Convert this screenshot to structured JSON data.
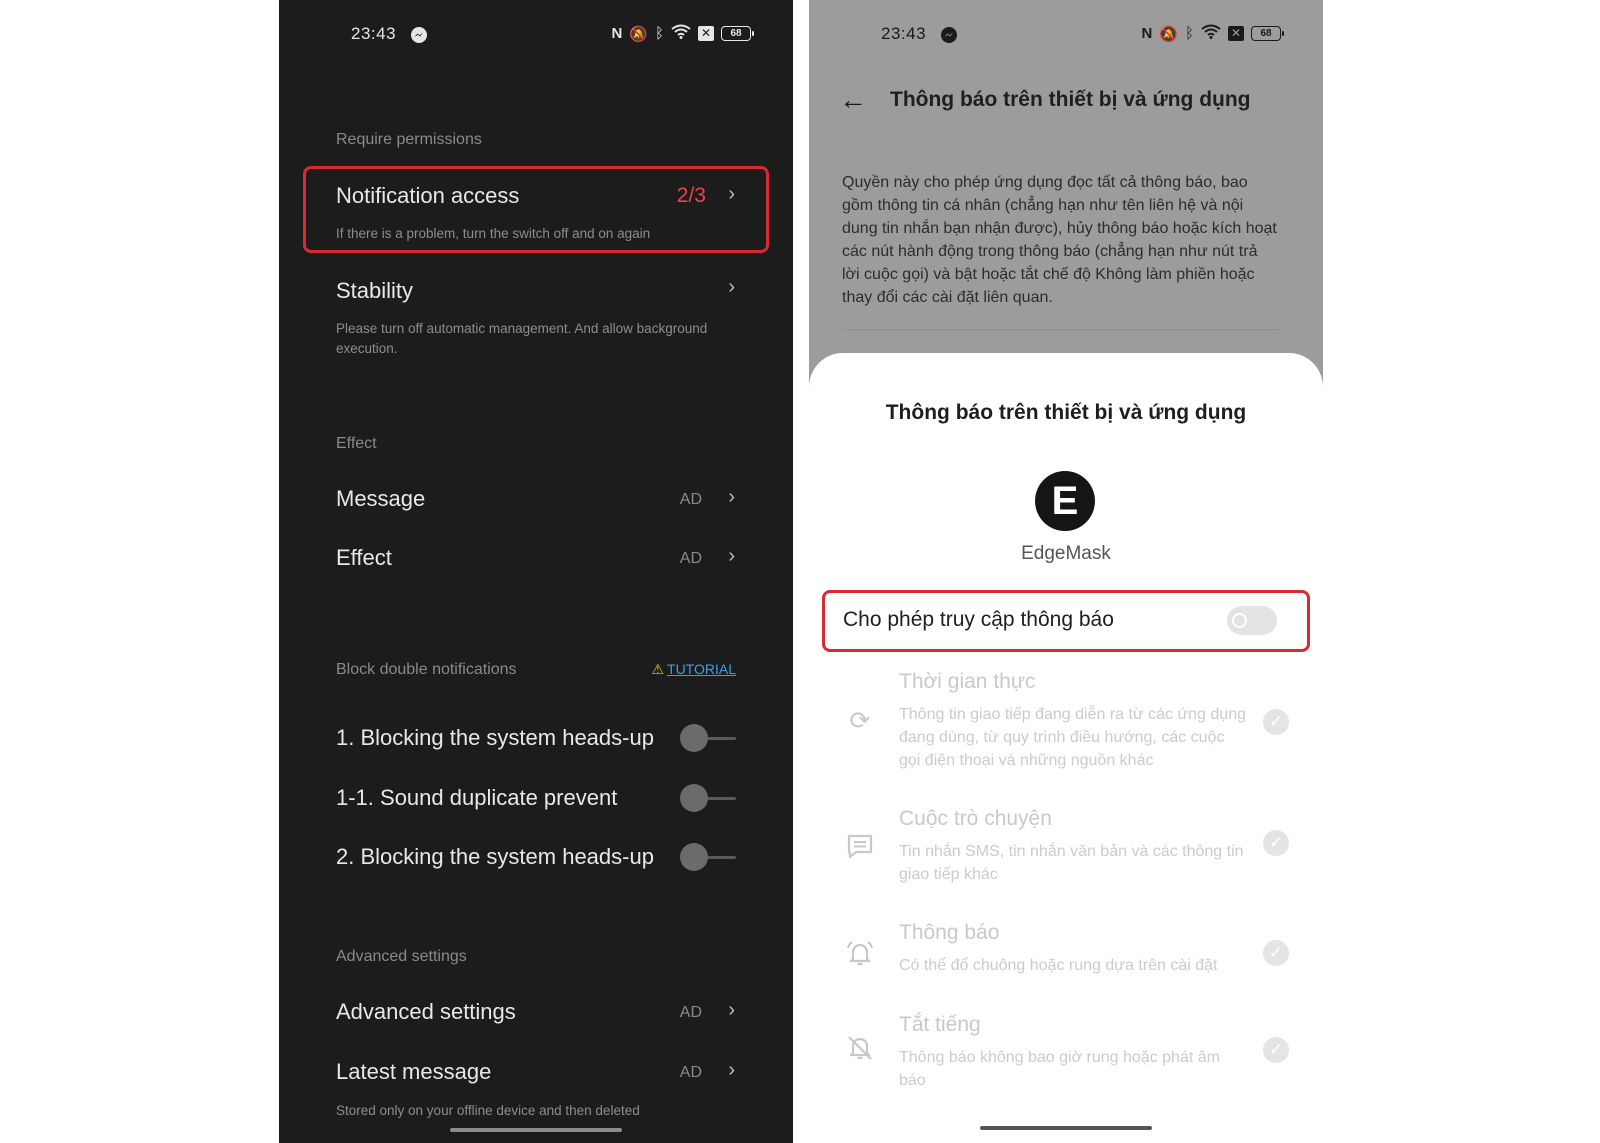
{
  "colors": {
    "left_bg": "#1c1c1c",
    "right_overlay_bg": "#9c9c9c",
    "highlight_red": "#d92a33",
    "counter_red": "#e5474f",
    "tutorial_blue": "#38a1e6"
  },
  "left": {
    "status": {
      "time": "23:43",
      "battery": "68",
      "icons": [
        "messenger-icon",
        "nfc-icon",
        "mute-icon",
        "bluetooth-icon",
        "wifi-icon",
        "sim-x-icon",
        "battery-icon"
      ]
    },
    "sections": {
      "require_permissions": "Require permissions",
      "effect": "Effect",
      "block_double": "Block double notifications",
      "advanced": "Advanced settings"
    },
    "notification_access": {
      "title": "Notification access",
      "counter": "2/3",
      "sub": "If there is a problem, turn the switch off and on again"
    },
    "stability": {
      "title": "Stability",
      "sub": "Please turn off automatic management. And allow background execution."
    },
    "message": {
      "title": "Message",
      "ad": "AD"
    },
    "effect_row": {
      "title": "Effect",
      "ad": "AD"
    },
    "tutorial": "TUTORIAL",
    "toggles": [
      {
        "label": "1. Blocking the system heads-up",
        "on": false
      },
      {
        "label": "1-1. Sound duplicate prevent",
        "on": false
      },
      {
        "label": "2. Blocking the system heads-up",
        "on": false
      }
    ],
    "advanced_row": {
      "title": "Advanced settings",
      "ad": "AD"
    },
    "latest_message": {
      "title": "Latest message",
      "ad": "AD",
      "sub": "Stored only on your offline device and then deleted"
    }
  },
  "right": {
    "status": {
      "time": "23:43",
      "battery": "68"
    },
    "topbar_title": "Thông báo trên thiết bị và ứng dụng",
    "description": "Quyền này cho phép ứng dụng đọc tất cả thông báo, bao gồm thông tin cá nhân (chẳng hạn như tên liên hệ và nội dung tin nhắn bạn nhận được), hủy thông báo hoặc kích hoạt các nút hành động trong thông báo (chẳng hạn như nút trả lời cuộc gọi) và bật hoặc tắt chế độ Không làm phiền hoặc thay đổi các cài đặt liên quan.",
    "sheet": {
      "title": "Thông báo trên thiết bị và ứng dụng",
      "app_icon_letter": "E",
      "app_name": "EdgeMask",
      "allow_label": "Cho phép truy cập thông báo",
      "allow_on": false,
      "permissions": [
        {
          "icon": "sync-icon",
          "title": "Thời gian thực",
          "desc": "Thông tin giao tiếp đang diễn ra từ các ứng dụng đang dùng, từ quy trình điều hướng, các cuộc gọi điện thoại và những nguồn khác"
        },
        {
          "icon": "chat-icon",
          "title": "Cuộc trò chuyện",
          "desc": "Tin nhắn SMS, tin nhắn văn bản và các thông tin giao tiếp khác"
        },
        {
          "icon": "bell-icon",
          "title": "Thông báo",
          "desc": "Có thể đổ chuông hoặc rung dựa trên cài đặt"
        },
        {
          "icon": "bell-off-icon",
          "title": "Tắt tiếng",
          "desc": "Thông báo không bao giờ rung hoặc phát âm báo"
        }
      ]
    }
  }
}
